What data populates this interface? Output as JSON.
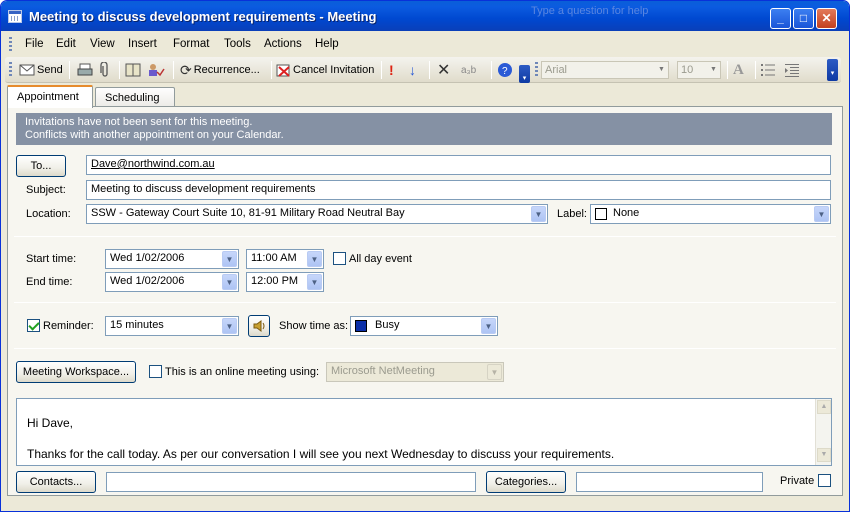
{
  "window": {
    "title": "Meeting to discuss development requirements - Meeting",
    "ghost_text": "Type a question for help",
    "buttons": {
      "minimize": "_",
      "maximize": "□",
      "close": "✕"
    }
  },
  "menu": [
    "File",
    "Edit",
    "View",
    "Insert",
    "Format",
    "Tools",
    "Actions",
    "Help"
  ],
  "toolbar": {
    "send": "Send",
    "recurrence": "Recurrence...",
    "cancel_invitation": "Cancel Invitation",
    "font": "Arial",
    "size": "10",
    "abc_glyph": "a₃b",
    "bold_a": "A"
  },
  "tabs": [
    "Appointment",
    "Scheduling"
  ],
  "info": {
    "line1": "Invitations have not been sent for this meeting.",
    "line2": "Conflicts with another appointment on your Calendar."
  },
  "form": {
    "to_button": "To...",
    "to_value": "Dave@northwind.com.au",
    "subject_label": "Subject:",
    "subject_value": "Meeting to discuss development requirements",
    "location_label": "Location:",
    "location_value": "SSW - Gateway Court Suite 10, 81-91 Military Road Neutral Bay",
    "label_label": "Label:",
    "label_value": "None",
    "start_label": "Start time:",
    "start_date": "Wed 1/02/2006",
    "start_time": "11:00 AM",
    "end_label": "End time:",
    "end_date": "Wed 1/02/2006",
    "end_time": "12:00 PM",
    "all_day": "All day event",
    "all_day_checked": false,
    "reminder_label": "Reminder:",
    "reminder_checked": true,
    "reminder_value": "15 minutes",
    "show_time_label": "Show time as:",
    "show_time_value": "Busy",
    "busy_color": "#0b2fa8",
    "workspace_button": "Meeting Workspace...",
    "online_label": "This is an online meeting using:",
    "online_value": "Microsoft NetMeeting"
  },
  "body": {
    "line1": "Hi Dave,",
    "line2": "Thanks for the call today. As per our conversation I will see you next Wednesday to discuss your requirements."
  },
  "footer": {
    "contacts_button": "Contacts...",
    "categories_button": "Categories...",
    "private_label": "Private"
  }
}
